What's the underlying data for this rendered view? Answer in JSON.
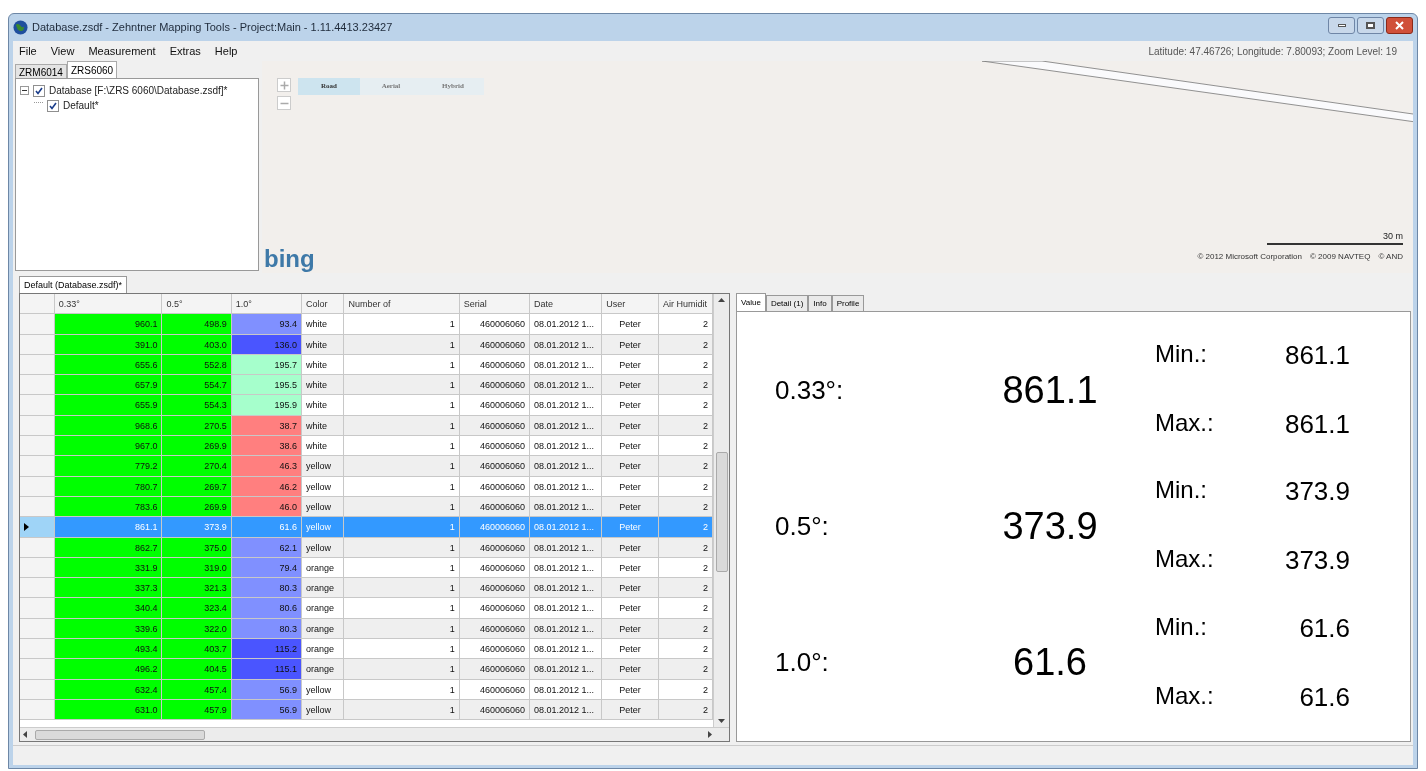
{
  "window": {
    "title": "Database.zsdf - Zehntner Mapping Tools - Project:Main - 1.11.4413.23427"
  },
  "menu": [
    "File",
    "View",
    "Measurement",
    "Extras",
    "Help"
  ],
  "coordinates": "Latitude: 47.46726; Longitude: 7.80093; Zoom Level: 19",
  "device_tabs": [
    {
      "label": "ZRM6014",
      "selected": false
    },
    {
      "label": "ZRS6060",
      "selected": true
    }
  ],
  "tree": [
    {
      "label": "Database [F:\\ZRS 6060\\Database.zsdf]*",
      "checked": true,
      "expanded": true,
      "children": [
        {
          "label": "Default*",
          "checked": true
        }
      ]
    }
  ],
  "map": {
    "modes": [
      {
        "label": "Road",
        "selected": true
      },
      {
        "label": "Aerial",
        "selected": false
      },
      {
        "label": "Hybrid",
        "selected": false
      }
    ],
    "logo": "bing",
    "scale": "30 m",
    "copyright": [
      "© 2012 Microsoft Corporation",
      "© 2009 NAVTEQ",
      "© AND"
    ]
  },
  "table_tab": "Default (Database.zsdf)*",
  "table": {
    "columns": [
      "0.33°",
      "0.5°",
      "1.0°",
      "Color",
      "Number of",
      "Serial",
      "Date",
      "User",
      "Air Humidit"
    ],
    "rows": [
      {
        "selected": false,
        "values": [
          {
            "text": "960.1",
            "color": "#00ff00"
          },
          {
            "text": "498.9",
            "color": "#00ff00"
          },
          {
            "text": "93.4",
            "color": "#8090ff"
          }
        ],
        "color_name": "white",
        "number": "1",
        "serial": "460006060",
        "date": "08.01.2012 1...",
        "user": "Peter",
        "air_humidity": "2"
      },
      {
        "selected": false,
        "values": [
          {
            "text": "391.0",
            "color": "#00ff00"
          },
          {
            "text": "403.0",
            "color": "#00ff00"
          },
          {
            "text": "136.0",
            "color": "#4a55ff"
          }
        ],
        "color_name": "white",
        "number": "1",
        "serial": "460006060",
        "date": "08.01.2012 1...",
        "user": "Peter",
        "air_humidity": "2"
      },
      {
        "selected": false,
        "values": [
          {
            "text": "655.6",
            "color": "#00ff00"
          },
          {
            "text": "552.8",
            "color": "#00ff00"
          },
          {
            "text": "195.7",
            "color": "#a6ffcc"
          }
        ],
        "color_name": "white",
        "number": "1",
        "serial": "460006060",
        "date": "08.01.2012 1...",
        "user": "Peter",
        "air_humidity": "2"
      },
      {
        "selected": false,
        "values": [
          {
            "text": "657.9",
            "color": "#00ff00"
          },
          {
            "text": "554.7",
            "color": "#00ff00"
          },
          {
            "text": "195.5",
            "color": "#a6ffcc"
          }
        ],
        "color_name": "white",
        "number": "1",
        "serial": "460006060",
        "date": "08.01.2012 1...",
        "user": "Peter",
        "air_humidity": "2"
      },
      {
        "selected": false,
        "values": [
          {
            "text": "655.9",
            "color": "#00ff00"
          },
          {
            "text": "554.3",
            "color": "#00ff00"
          },
          {
            "text": "195.9",
            "color": "#a6ffcc"
          }
        ],
        "color_name": "white",
        "number": "1",
        "serial": "460006060",
        "date": "08.01.2012 1...",
        "user": "Peter",
        "air_humidity": "2"
      },
      {
        "selected": false,
        "values": [
          {
            "text": "968.6",
            "color": "#00ff00"
          },
          {
            "text": "270.5",
            "color": "#00ff00"
          },
          {
            "text": "38.7",
            "color": "#ff7f7f"
          }
        ],
        "color_name": "white",
        "number": "1",
        "serial": "460006060",
        "date": "08.01.2012 1...",
        "user": "Peter",
        "air_humidity": "2"
      },
      {
        "selected": false,
        "values": [
          {
            "text": "967.0",
            "color": "#00ff00"
          },
          {
            "text": "269.9",
            "color": "#00ff00"
          },
          {
            "text": "38.6",
            "color": "#ff7f7f"
          }
        ],
        "color_name": "white",
        "number": "1",
        "serial": "460006060",
        "date": "08.01.2012 1...",
        "user": "Peter",
        "air_humidity": "2"
      },
      {
        "selected": false,
        "values": [
          {
            "text": "779.2",
            "color": "#00ff00"
          },
          {
            "text": "270.4",
            "color": "#00ff00"
          },
          {
            "text": "46.3",
            "color": "#ff7f7f"
          }
        ],
        "color_name": "yellow",
        "number": "1",
        "serial": "460006060",
        "date": "08.01.2012 1...",
        "user": "Peter",
        "air_humidity": "2"
      },
      {
        "selected": false,
        "values": [
          {
            "text": "780.7",
            "color": "#00ff00"
          },
          {
            "text": "269.7",
            "color": "#00ff00"
          },
          {
            "text": "46.2",
            "color": "#ff7f7f"
          }
        ],
        "color_name": "yellow",
        "number": "1",
        "serial": "460006060",
        "date": "08.01.2012 1...",
        "user": "Peter",
        "air_humidity": "2"
      },
      {
        "selected": false,
        "values": [
          {
            "text": "783.6",
            "color": "#00ff00"
          },
          {
            "text": "269.9",
            "color": "#00ff00"
          },
          {
            "text": "46.0",
            "color": "#ff7f7f"
          }
        ],
        "color_name": "yellow",
        "number": "1",
        "serial": "460006060",
        "date": "08.01.2012 1...",
        "user": "Peter",
        "air_humidity": "2"
      },
      {
        "selected": true,
        "values": [
          {
            "text": "861.1"
          },
          {
            "text": "373.9"
          },
          {
            "text": "61.6"
          }
        ],
        "color_name": "yellow",
        "number": "1",
        "serial": "460006060",
        "date": "08.01.2012 1...",
        "user": "Peter",
        "air_humidity": "2"
      },
      {
        "selected": false,
        "values": [
          {
            "text": "862.7",
            "color": "#00ff00"
          },
          {
            "text": "375.0",
            "color": "#00ff00"
          },
          {
            "text": "62.1",
            "color": "#8090ff"
          }
        ],
        "color_name": "yellow",
        "number": "1",
        "serial": "460006060",
        "date": "08.01.2012 1...",
        "user": "Peter",
        "air_humidity": "2"
      },
      {
        "selected": false,
        "values": [
          {
            "text": "331.9",
            "color": "#00ff00"
          },
          {
            "text": "319.0",
            "color": "#00ff00"
          },
          {
            "text": "79.4",
            "color": "#8090ff"
          }
        ],
        "color_name": "orange",
        "number": "1",
        "serial": "460006060",
        "date": "08.01.2012 1...",
        "user": "Peter",
        "air_humidity": "2"
      },
      {
        "selected": false,
        "values": [
          {
            "text": "337.3",
            "color": "#00ff00"
          },
          {
            "text": "321.3",
            "color": "#00ff00"
          },
          {
            "text": "80.3",
            "color": "#8090ff"
          }
        ],
        "color_name": "orange",
        "number": "1",
        "serial": "460006060",
        "date": "08.01.2012 1...",
        "user": "Peter",
        "air_humidity": "2"
      },
      {
        "selected": false,
        "values": [
          {
            "text": "340.4",
            "color": "#00ff00"
          },
          {
            "text": "323.4",
            "color": "#00ff00"
          },
          {
            "text": "80.6",
            "color": "#8090ff"
          }
        ],
        "color_name": "orange",
        "number": "1",
        "serial": "460006060",
        "date": "08.01.2012 1...",
        "user": "Peter",
        "air_humidity": "2"
      },
      {
        "selected": false,
        "values": [
          {
            "text": "339.6",
            "color": "#00ff00"
          },
          {
            "text": "322.0",
            "color": "#00ff00"
          },
          {
            "text": "80.3",
            "color": "#8090ff"
          }
        ],
        "color_name": "orange",
        "number": "1",
        "serial": "460006060",
        "date": "08.01.2012 1...",
        "user": "Peter",
        "air_humidity": "2"
      },
      {
        "selected": false,
        "values": [
          {
            "text": "493.4",
            "color": "#00ff00"
          },
          {
            "text": "403.7",
            "color": "#00ff00"
          },
          {
            "text": "115.2",
            "color": "#4a55ff"
          }
        ],
        "color_name": "orange",
        "number": "1",
        "serial": "460006060",
        "date": "08.01.2012 1...",
        "user": "Peter",
        "air_humidity": "2"
      },
      {
        "selected": false,
        "values": [
          {
            "text": "496.2",
            "color": "#00ff00"
          },
          {
            "text": "404.5",
            "color": "#00ff00"
          },
          {
            "text": "115.1",
            "color": "#4a55ff"
          }
        ],
        "color_name": "orange",
        "number": "1",
        "serial": "460006060",
        "date": "08.01.2012 1...",
        "user": "Peter",
        "air_humidity": "2"
      },
      {
        "selected": false,
        "values": [
          {
            "text": "632.4",
            "color": "#00ff00"
          },
          {
            "text": "457.4",
            "color": "#00ff00"
          },
          {
            "text": "56.9",
            "color": "#8090ff"
          }
        ],
        "color_name": "yellow",
        "number": "1",
        "serial": "460006060",
        "date": "08.01.2012 1...",
        "user": "Peter",
        "air_humidity": "2"
      },
      {
        "selected": false,
        "values": [
          {
            "text": "631.0",
            "color": "#00ff00"
          },
          {
            "text": "457.9",
            "color": "#00ff00"
          },
          {
            "text": "56.9",
            "color": "#8090ff"
          }
        ],
        "color_name": "yellow",
        "number": "1",
        "serial": "460006060",
        "date": "08.01.2012 1...",
        "user": "Peter",
        "air_humidity": "2"
      }
    ]
  },
  "detail_tabs": [
    {
      "label": "Value",
      "selected": true
    },
    {
      "label": "Detail (1)",
      "selected": false
    },
    {
      "label": "Info",
      "selected": false
    },
    {
      "label": "Profile",
      "selected": false
    }
  ],
  "readings": [
    {
      "label": "0.33°:",
      "value": "861.1",
      "min_label": "Min.:",
      "min": "861.1",
      "max_label": "Max.:",
      "max": "861.1"
    },
    {
      "label": "0.5°:",
      "value": "373.9",
      "min_label": "Min.:",
      "min": "373.9",
      "max_label": "Max.:",
      "max": "373.9"
    },
    {
      "label": "1.0°:",
      "value": "61.6",
      "min_label": "Min.:",
      "min": "61.6",
      "max_label": "Max.:",
      "max": "61.6"
    }
  ]
}
